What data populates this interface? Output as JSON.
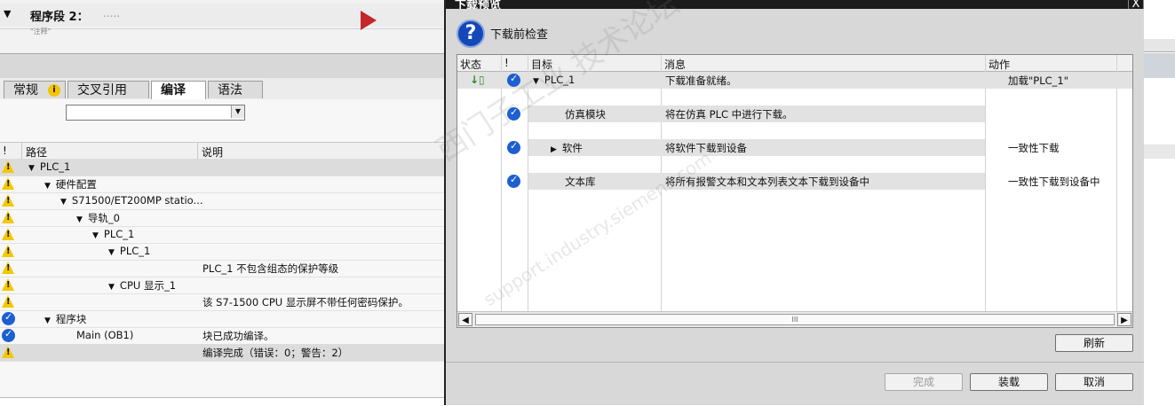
{
  "segment": {
    "title": "程序段 2：",
    "dots": ".....",
    "sub": "\"注释\""
  },
  "inspector": {
    "tabs": [
      "常规",
      "交叉引用",
      "编译",
      "语法"
    ],
    "filter_value": "",
    "columns": {
      "mark": "!",
      "path": "路径",
      "desc": "说明"
    },
    "rows": [
      {
        "icon": "warning",
        "indent": 0,
        "expand": "▼",
        "path": "PLC_1",
        "desc": "",
        "selected": true
      },
      {
        "icon": "warning",
        "indent": 1,
        "expand": "▼",
        "path": "硬件配置",
        "desc": ""
      },
      {
        "icon": "warning",
        "indent": 2,
        "expand": "▼",
        "path": "S71500/ET200MP statio...",
        "desc": ""
      },
      {
        "icon": "warning",
        "indent": 3,
        "expand": "▼",
        "path": "导轨_0",
        "desc": ""
      },
      {
        "icon": "warning",
        "indent": 4,
        "expand": "▼",
        "path": "PLC_1",
        "desc": ""
      },
      {
        "icon": "warning",
        "indent": 5,
        "expand": "▼",
        "path": "PLC_1",
        "desc": ""
      },
      {
        "icon": "warning",
        "indent": 6,
        "expand": "",
        "path": "",
        "desc": "PLC_1 不包含组态的保护等级"
      },
      {
        "icon": "warning",
        "indent": 5,
        "expand": "▼",
        "path": "CPU 显示_1",
        "desc": ""
      },
      {
        "icon": "warning",
        "indent": 6,
        "expand": "",
        "path": "",
        "desc": "该 S7-1500 CPU 显示屏不带任何密码保护。"
      },
      {
        "icon": "ok",
        "indent": 1,
        "expand": "▼",
        "path": "程序块",
        "desc": ""
      },
      {
        "icon": "ok",
        "indent": 3,
        "expand": "",
        "path": "Main (OB1)",
        "desc": "块已成功编译。"
      },
      {
        "icon": "warning",
        "indent": 0,
        "expand": "",
        "path": "",
        "desc": "编译完成（错误：0；警告：2）",
        "selected": true
      }
    ]
  },
  "dialog": {
    "title": "下载预览",
    "heading": "下载前检查",
    "columns": {
      "status": "状态",
      "mark": "!",
      "target": "目标",
      "message": "消息",
      "action": "动作"
    },
    "rows": [
      {
        "target": "PLC_1",
        "expand": "▼",
        "message": "下载准备就绪。",
        "action": "加载\"PLC_1\"",
        "status_icon": "download-ready",
        "highlight": true
      },
      {
        "target": "仿真模块",
        "expand": "",
        "message": "将在仿真 PLC 中进行下载。",
        "action": ""
      },
      {
        "target": "软件",
        "expand": "▶",
        "message": "将软件下载到设备",
        "action": "一致性下载"
      },
      {
        "target": "文本库",
        "expand": "",
        "message": "将所有报警文本和文本列表文本下载到设备中",
        "action": "一致性下载到设备中"
      }
    ],
    "scroll_grip": "III",
    "buttons": {
      "refresh": "刷新",
      "finish": "完成",
      "load": "装载",
      "cancel": "取消"
    },
    "close": "X"
  },
  "watermark": {
    "line1": "西门子工业 技术论坛",
    "line2": "support.industry.siemens.com"
  }
}
